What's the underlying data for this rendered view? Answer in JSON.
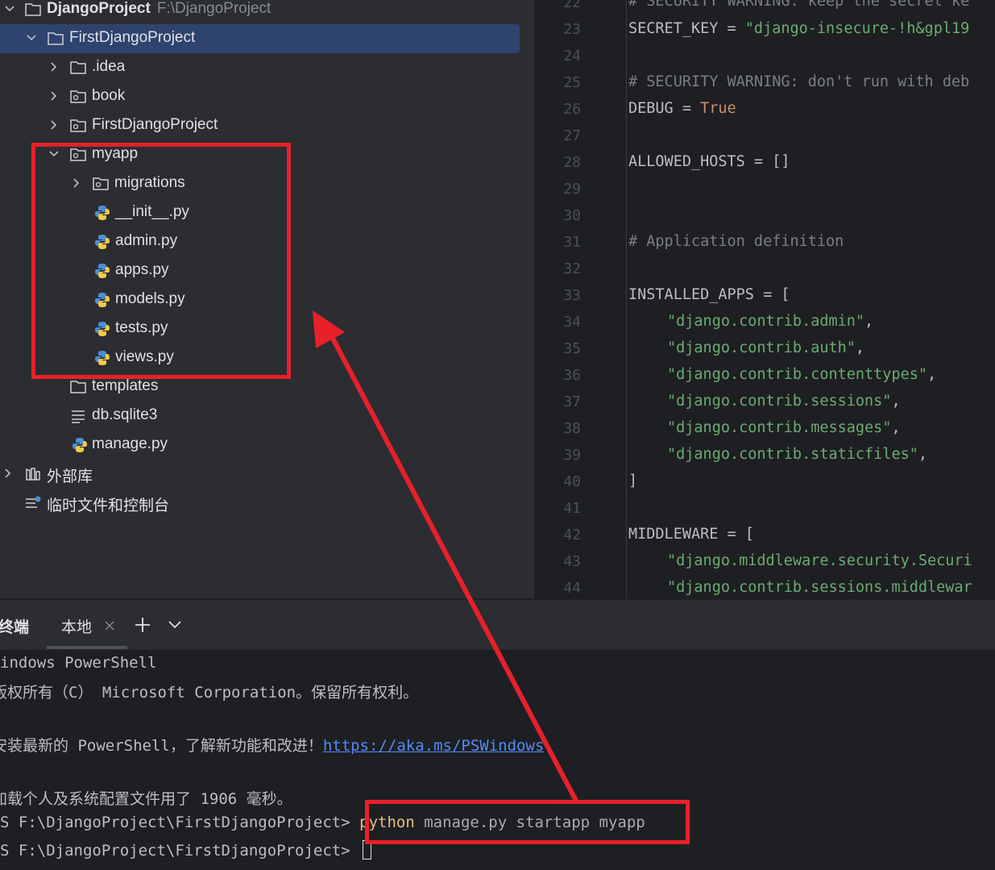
{
  "project_tree": {
    "root": {
      "name": "DjangoProject",
      "path": "F:\\DjangoProject"
    },
    "items": [
      {
        "label": "FirstDjangoProject"
      },
      {
        "label": ".idea"
      },
      {
        "label": "book"
      },
      {
        "label": "FirstDjangoProject"
      },
      {
        "label": "myapp"
      },
      {
        "label": "migrations"
      },
      {
        "label": "__init__.py"
      },
      {
        "label": "admin.py"
      },
      {
        "label": "apps.py"
      },
      {
        "label": "models.py"
      },
      {
        "label": "tests.py"
      },
      {
        "label": "views.py"
      },
      {
        "label": "templates"
      },
      {
        "label": "db.sqlite3"
      },
      {
        "label": "manage.py"
      },
      {
        "label": "外部库"
      },
      {
        "label": "临时文件和控制台"
      }
    ]
  },
  "editor": {
    "line_numbers": [
      "22",
      "23",
      "24",
      "25",
      "26",
      "27",
      "28",
      "29",
      "30",
      "31",
      "32",
      "33",
      "34",
      "35",
      "36",
      "37",
      "38",
      "39",
      "40",
      "41",
      "42",
      "43",
      "44"
    ],
    "lines": [
      "# SECURITY WARNING: keep the secret ke",
      "SECRET_KEY = ",
      "\"django-insecure-!h&gpl19",
      "",
      "# SECURITY WARNING: don't run with deb",
      "DEBUG = ",
      "True",
      "",
      "ALLOWED_HOSTS = []",
      "",
      "",
      "# Application definition",
      "",
      "INSTALLED_APPS = [",
      "\"django.contrib.admin\"",
      "\"django.contrib.auth\"",
      "\"django.contrib.contenttypes\"",
      "\"django.contrib.sessions\"",
      "\"django.contrib.messages\"",
      "\"django.contrib.staticfiles\"",
      "]",
      "",
      "MIDDLEWARE = [",
      "\"django.middleware.security.Securi",
      "\"django.contrib.sessions.middlewar"
    ]
  },
  "terminal": {
    "title": "终端",
    "tab_label": "本地",
    "lines": [
      "indows PowerShell",
      "版权所有（C） Microsoft Corporation。保留所有权利。",
      "",
      "安装最新的 PowerShell，了解新功能和改进！",
      "https://aka.ms/PSWindows",
      "",
      "加载个人及系统配置文件用了 1906 毫秒。",
      "S F:\\DjangoProject\\FirstDjangoProject> ",
      "python",
      " manage.py startapp myapp",
      "S F:\\DjangoProject\\FirstDjangoProject> "
    ]
  },
  "colors": {
    "highlight": "#e8202a",
    "selection": "#2e436e",
    "string": "#6aab73",
    "keyword": "#cf8e6d"
  }
}
